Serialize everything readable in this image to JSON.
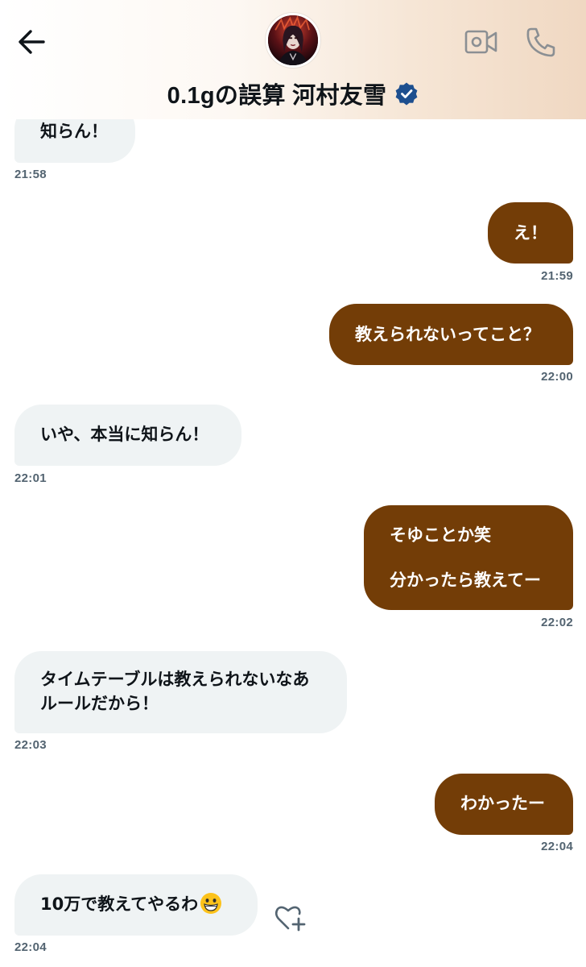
{
  "header": {
    "title": "0.1gの誤算 河村友雪"
  },
  "icons": {
    "back": "arrow-left-icon",
    "video": "video-camera-icon",
    "phone": "phone-icon",
    "verified": "verified-badge-icon",
    "react": "heart-plus-icon",
    "emoji": "grinning-face-emoji"
  },
  "colors": {
    "outgoing_bubble": "#733d07",
    "incoming_bubble": "#eff3f4",
    "verified_badge": "#1d4f8f",
    "timestamp": "#536471"
  },
  "messages": [
    {
      "direction": "in",
      "lines": [
        "知らん！"
      ],
      "time": "21:58"
    },
    {
      "direction": "out",
      "lines": [
        "え！"
      ],
      "time": "21:59"
    },
    {
      "direction": "out",
      "lines": [
        "教えられないってこと？"
      ],
      "time": "22:00"
    },
    {
      "direction": "in",
      "lines": [
        "いや、本当に知らん！"
      ],
      "time": "22:01"
    },
    {
      "direction": "out",
      "lines": [
        "そゆことか笑",
        "分かったら教えてー"
      ],
      "time": "22:02"
    },
    {
      "direction": "in",
      "lines": [
        "タイムテーブルは教えられないなあ",
        "ルールだから！"
      ],
      "time": "22:03"
    },
    {
      "direction": "out",
      "lines": [
        "わかったー"
      ],
      "time": "22:04"
    },
    {
      "direction": "in",
      "lines": [
        "10万で教えてやるわ"
      ],
      "time": "22:04"
    }
  ]
}
